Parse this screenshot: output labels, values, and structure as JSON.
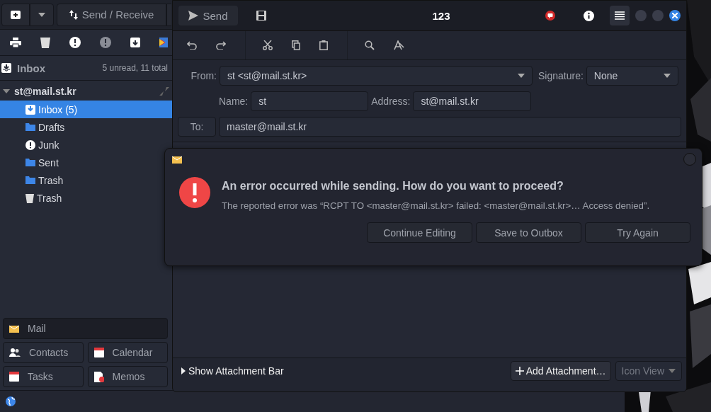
{
  "main_window": {
    "send_receive": "Send / Receive",
    "folder_header": {
      "title": "Inbox",
      "counts": "5 unread, 11 total"
    },
    "account": {
      "name": "st@mail.st.kr",
      "expanded": true,
      "folders": [
        {
          "name": "Inbox (5)",
          "kind": "inbox",
          "selected": true
        },
        {
          "name": "Drafts",
          "kind": "folder",
          "selected": false
        },
        {
          "name": "Junk",
          "kind": "junk",
          "selected": false
        },
        {
          "name": "Sent",
          "kind": "folder",
          "selected": false
        },
        {
          "name": "Trash",
          "kind": "folder",
          "selected": false
        },
        {
          "name": "Trash",
          "kind": "trash",
          "selected": false
        }
      ]
    },
    "switcher": [
      [
        {
          "label": "Mail",
          "kind": "mail",
          "selected": true
        }
      ],
      [
        {
          "label": "Contacts",
          "kind": "contacts",
          "selected": false
        },
        {
          "label": "Calendar",
          "kind": "calendar",
          "selected": false
        }
      ],
      [
        {
          "label": "Tasks",
          "kind": "calendar",
          "selected": false
        },
        {
          "label": "Memos",
          "kind": "memos",
          "selected": false
        }
      ]
    ]
  },
  "composer": {
    "send": "Send",
    "title": "123",
    "from": {
      "label": "From:",
      "value": "st <st@mail.st.kr>"
    },
    "signature": {
      "label": "Signature:",
      "value": "None"
    },
    "name": {
      "label": "Name:",
      "value": "st"
    },
    "address": {
      "label": "Address:",
      "value": "st@mail.st.kr"
    },
    "to": {
      "label": "To:",
      "value": "master@mail.st.kr"
    },
    "attachment_bar": {
      "label": "Show Attachment Bar",
      "expanded": false
    },
    "add_attachment": "Add Attachment…",
    "view_mode": "Icon View"
  },
  "dialog": {
    "heading": "An error occurred while sending. How do you want to proceed?",
    "message": "The reported error was “RCPT TO <master@mail.st.kr> failed: <master@mail.st.kr>… Access denied”.",
    "buttons": [
      "Continue Editing",
      "Save to Outbox",
      "Try Again"
    ]
  }
}
